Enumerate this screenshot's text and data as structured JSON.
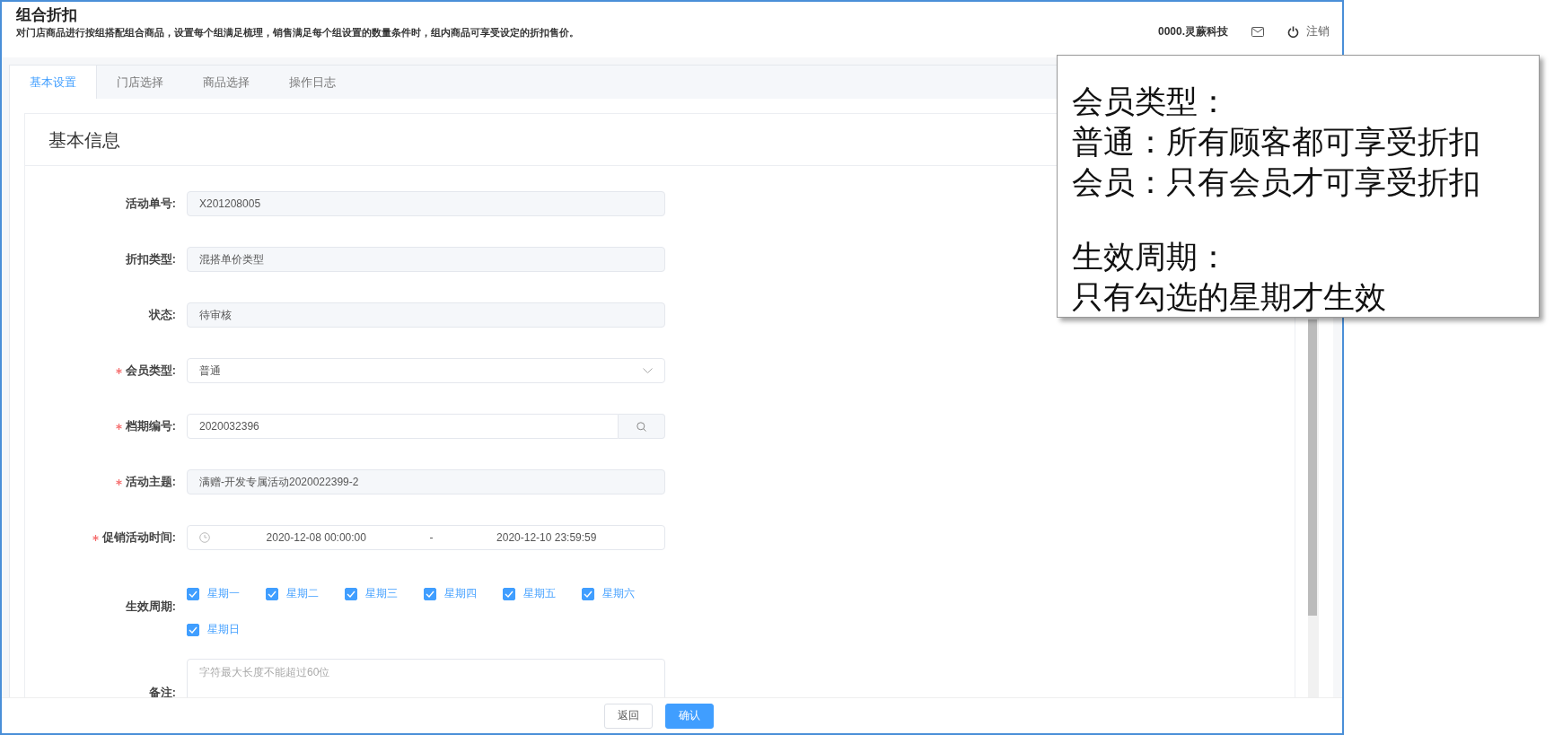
{
  "header": {
    "title": "组合折扣",
    "subtitle": "对门店商品进行按组搭配组合商品，设置每个组满足梳理，销售满足每个组设置的数量条件时，组内商品可享受设定的折扣售价。",
    "company": "0000.灵蕨科技",
    "logout": "注销"
  },
  "tabs": [
    {
      "label": "基本设置",
      "selected": true
    },
    {
      "label": "门店选择",
      "selected": false
    },
    {
      "label": "商品选择",
      "selected": false
    },
    {
      "label": "操作日志",
      "selected": false
    }
  ],
  "section_title": "基本信息",
  "fields": [
    {
      "label": "活动单号:",
      "kind": "readonly",
      "required": false,
      "value": "X201208005"
    },
    {
      "label": "折扣类型:",
      "kind": "readonly",
      "required": false,
      "value": "混搭单价类型"
    },
    {
      "label": "状态:",
      "kind": "readonly",
      "required": false,
      "value": "待审核"
    },
    {
      "label": "会员类型:",
      "kind": "select",
      "required": true,
      "value": "普通"
    },
    {
      "label": "档期编号:",
      "kind": "search",
      "required": true,
      "value": "2020032396"
    },
    {
      "label": "活动主题:",
      "kind": "readonly",
      "required": true,
      "value": "满赠-开发专属活动2020022399-2"
    },
    {
      "label": "促销活动时间:",
      "kind": "daterange",
      "required": true,
      "start": "2020-12-08 00:00:00",
      "separator": "-",
      "end": "2020-12-10 23:59:59"
    }
  ],
  "weekdays": {
    "label": "生效周期:",
    "days": [
      {
        "label": "星期一",
        "checked": true
      },
      {
        "label": "星期二",
        "checked": true
      },
      {
        "label": "星期三",
        "checked": true
      },
      {
        "label": "星期四",
        "checked": true
      },
      {
        "label": "星期五",
        "checked": true
      },
      {
        "label": "星期六",
        "checked": true
      },
      {
        "label": "星期日",
        "checked": true
      }
    ]
  },
  "remark": {
    "label": "备注:",
    "placeholder": "字符最大长度不能超过60位"
  },
  "buttons": [
    {
      "label": "返回",
      "kind": "default"
    },
    {
      "label": "确认",
      "kind": "primary"
    }
  ],
  "callout": {
    "groups": [
      [
        "会员类型：",
        "普通：所有顾客都可享受折扣",
        "会员：只有会员才可享受折扣"
      ],
      [
        "生效周期：",
        "只有勾选的星期才生效"
      ]
    ]
  }
}
